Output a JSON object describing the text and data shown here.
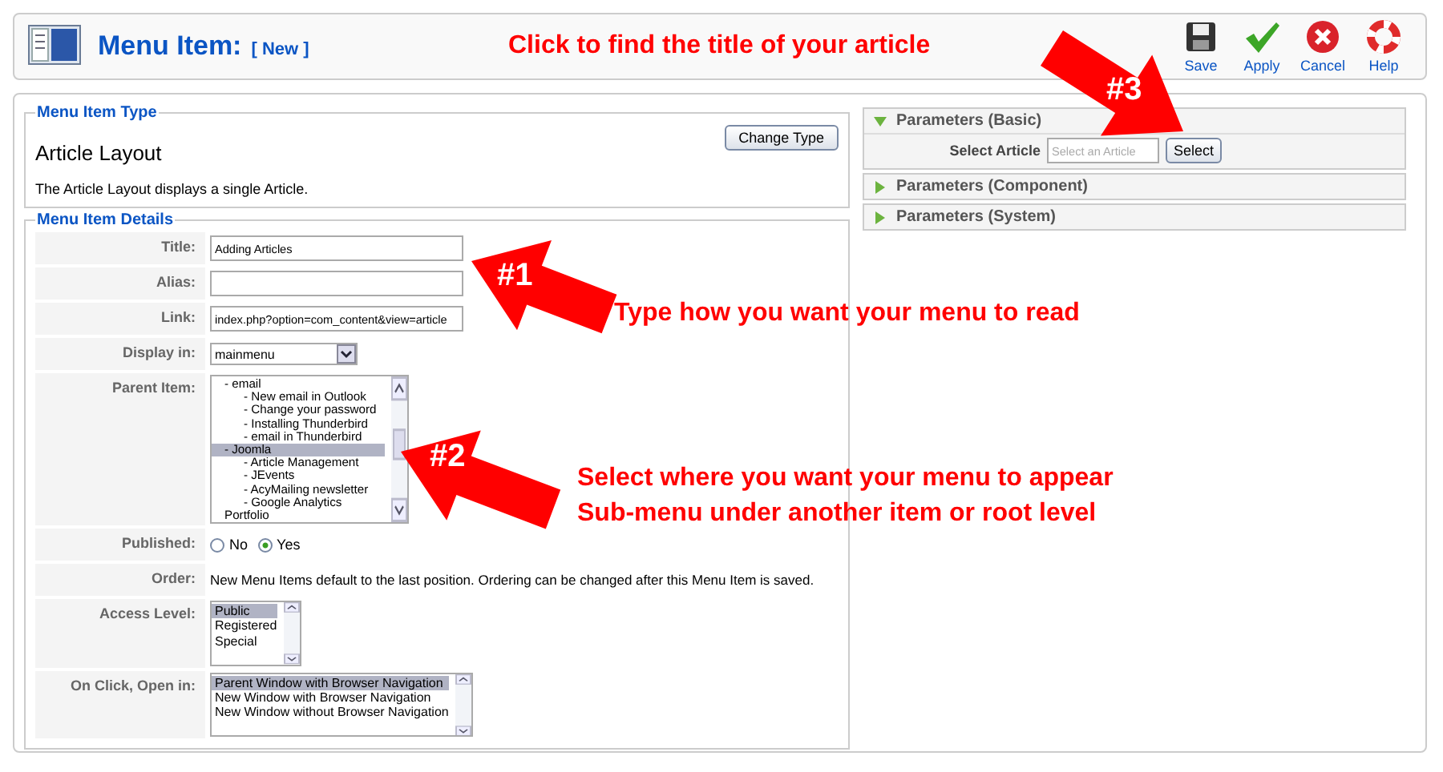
{
  "header": {
    "title": "Menu Item:",
    "badge": "[ New ]"
  },
  "toolbar": [
    {
      "label": "Save",
      "kind": "save"
    },
    {
      "label": "Apply",
      "kind": "apply"
    },
    {
      "label": "Cancel",
      "kind": "cancel"
    },
    {
      "label": "Help",
      "kind": "help"
    }
  ],
  "menu_item_type": {
    "legend": "Menu Item Type",
    "heading": "Article Layout",
    "button": "Change Type",
    "description": "The Article Layout displays a single Article."
  },
  "details": {
    "legend": "Menu Item Details",
    "fields": [
      {
        "label": "Title:",
        "kind": "text",
        "value": "Adding Articles"
      },
      {
        "label": "Alias:",
        "kind": "text"
      },
      {
        "label": "Link:",
        "kind": "text",
        "value": "index.php?option=com_content&view=article"
      },
      {
        "label": "Display in:",
        "kind": "select",
        "value": "mainmenu"
      },
      {
        "label": "Parent Item:",
        "kind": "tree",
        "options": [
          {
            "label": "- email",
            "selected": false,
            "children": [
              {
                "label": "- New email in Outlook",
                "selected": false
              },
              {
                "label": "- Change your password",
                "selected": false
              },
              {
                "label": "- Installing Thunderbird",
                "selected": false
              },
              {
                "label": "- email in Thunderbird",
                "selected": false
              }
            ]
          },
          {
            "label": "- Joomla",
            "selected": true,
            "children": [
              {
                "label": "- Article Management",
                "selected": false
              },
              {
                "label": "- JEvents",
                "selected": false
              },
              {
                "label": "- AcyMailing newsletter",
                "selected": false
              },
              {
                "label": "- Google Analytics",
                "selected": false
              }
            ]
          },
          {
            "label": "Portfolio",
            "selected": false
          }
        ]
      },
      {
        "label": "Published:",
        "kind": "radio",
        "options": [
          {
            "label": "No",
            "selected": false
          },
          {
            "label": "Yes",
            "selected": true
          }
        ]
      },
      {
        "label": "Order:",
        "kind": "note",
        "text": "New Menu Items default to the last position. Ordering can be changed after this Menu Item is saved."
      },
      {
        "label": "Access Level:",
        "kind": "list",
        "options": [
          {
            "label": "Public",
            "selected": true
          },
          {
            "label": "Registered",
            "selected": false
          },
          {
            "label": "Special",
            "selected": false
          }
        ]
      },
      {
        "label": "On Click, Open in:",
        "kind": "list",
        "options": [
          {
            "label": "Parent Window with Browser Navigation",
            "selected": true
          },
          {
            "label": "New Window with Browser Navigation",
            "selected": false
          },
          {
            "label": "New Window without Browser Navigation",
            "selected": false
          }
        ]
      }
    ]
  },
  "parameters": [
    {
      "title": "Parameters (Basic)",
      "expanded": true,
      "field": {
        "label": "Select Article",
        "placeholder": "Select an Article",
        "button": "Select"
      }
    },
    {
      "title": "Parameters (Component)",
      "expanded": false
    },
    {
      "title": "Parameters (System)",
      "expanded": false
    }
  ],
  "annotations": {
    "header_note": "Click to find the title of your article",
    "arrows": [
      {
        "label": "#1",
        "note": [
          "Type how you want your menu to read"
        ]
      },
      {
        "label": "#2",
        "note": [
          "Select where you want your menu to appear",
          "Sub-menu under another item or root level"
        ]
      },
      {
        "label": "#3"
      }
    ]
  }
}
